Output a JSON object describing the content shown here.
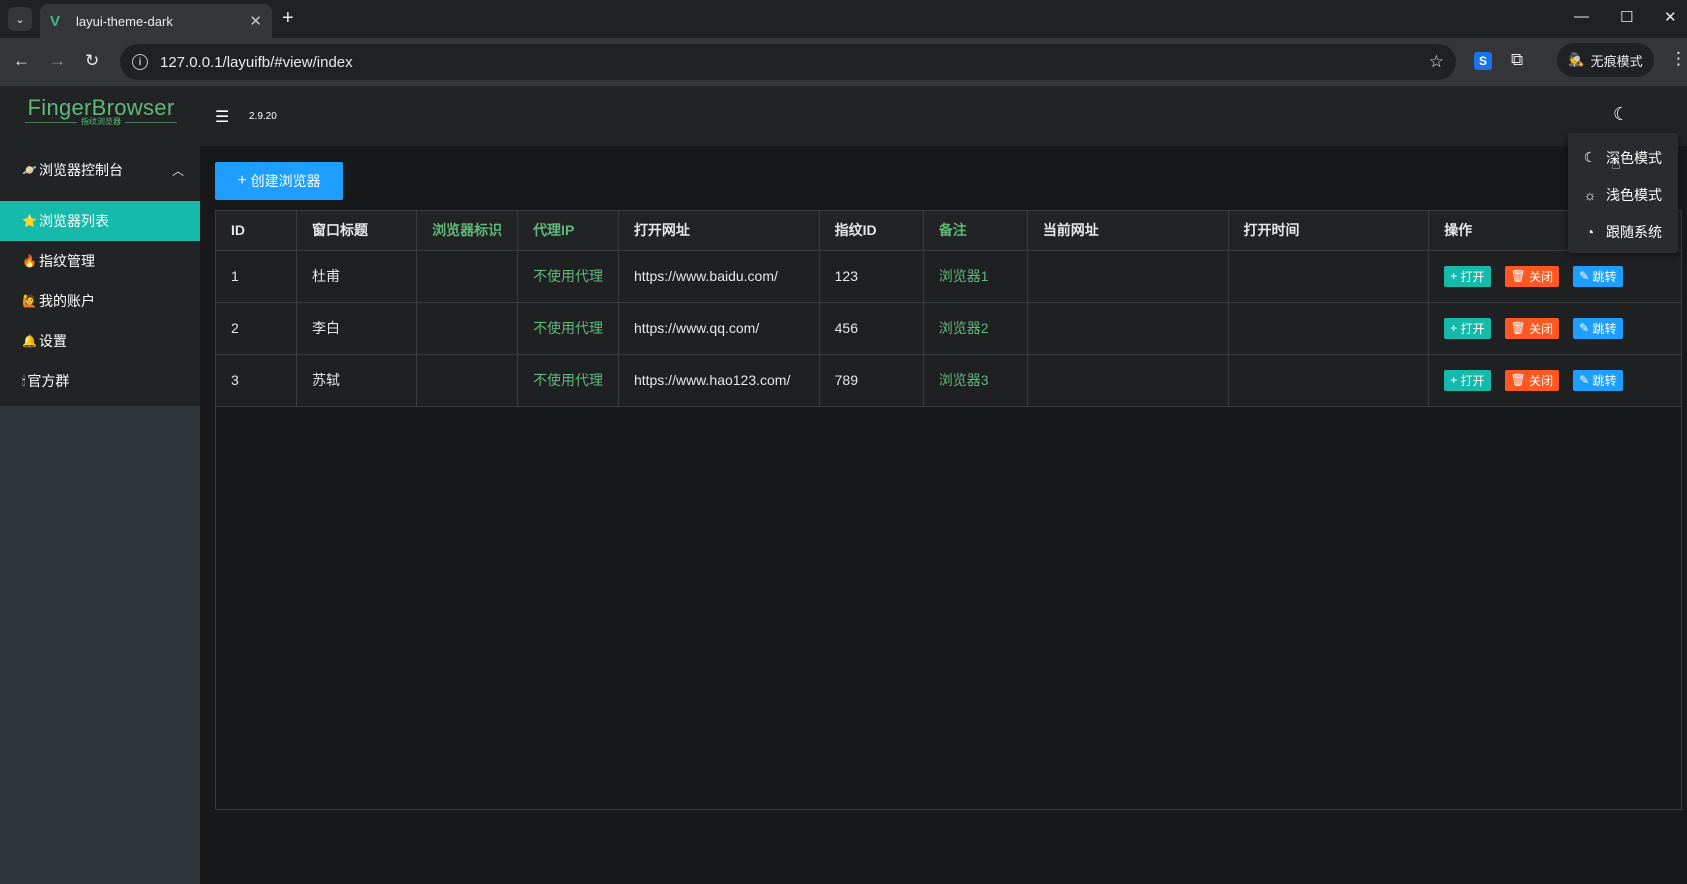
{
  "browser": {
    "tab_title": "layui-theme-dark",
    "url": "127.0.0.1/layuifb/#view/index",
    "incognito_label": "无痕模式"
  },
  "app": {
    "logo_name": "FingerBrowser",
    "logo_sub": "指纹浏览器",
    "version": "2.9.20"
  },
  "sidebar": {
    "group": {
      "icon": "🪐",
      "label": "浏览器控制台"
    },
    "items": [
      {
        "icon": "⭐",
        "label": "浏览器列表"
      },
      {
        "icon": "🔥",
        "label": "指纹管理"
      },
      {
        "icon": "🙋",
        "label": "我的账户"
      },
      {
        "icon": "🔔",
        "label": "设置"
      },
      {
        "icon": "🕯",
        "label": "官方群"
      }
    ]
  },
  "toolbar": {
    "create_label": "创建浏览器"
  },
  "table": {
    "columns": [
      "ID",
      "窗口标题",
      "浏览器标识",
      "代理IP",
      "打开网址",
      "指纹ID",
      "备注",
      "当前网址",
      "打开时间",
      "操作"
    ],
    "rows": [
      {
        "id": "1",
        "title": "杜甫",
        "browser_tag": "",
        "proxy": "不使用代理",
        "url": "https://www.baidu.com/",
        "fp_id": "123",
        "note": "浏览器1",
        "current_url": "",
        "open_time": ""
      },
      {
        "id": "2",
        "title": "李白",
        "browser_tag": "",
        "proxy": "不使用代理",
        "url": "https://www.qq.com/",
        "fp_id": "456",
        "note": "浏览器2",
        "current_url": "",
        "open_time": ""
      },
      {
        "id": "3",
        "title": "苏轼",
        "browser_tag": "",
        "proxy": "不使用代理",
        "url": "https://www.hao123.com/",
        "fp_id": "789",
        "note": "浏览器3",
        "current_url": "",
        "open_time": ""
      }
    ],
    "actions": {
      "open": "打开",
      "close": "关闭",
      "jump": "跳转"
    }
  },
  "theme_menu": {
    "items": [
      "深色模式",
      "浅色模式",
      "跟随系统"
    ]
  },
  "colors": {
    "accent_green": "#16baaa",
    "primary_blue": "#1e9fff",
    "danger_orange": "#ff5722",
    "text_green": "#5fb878"
  }
}
